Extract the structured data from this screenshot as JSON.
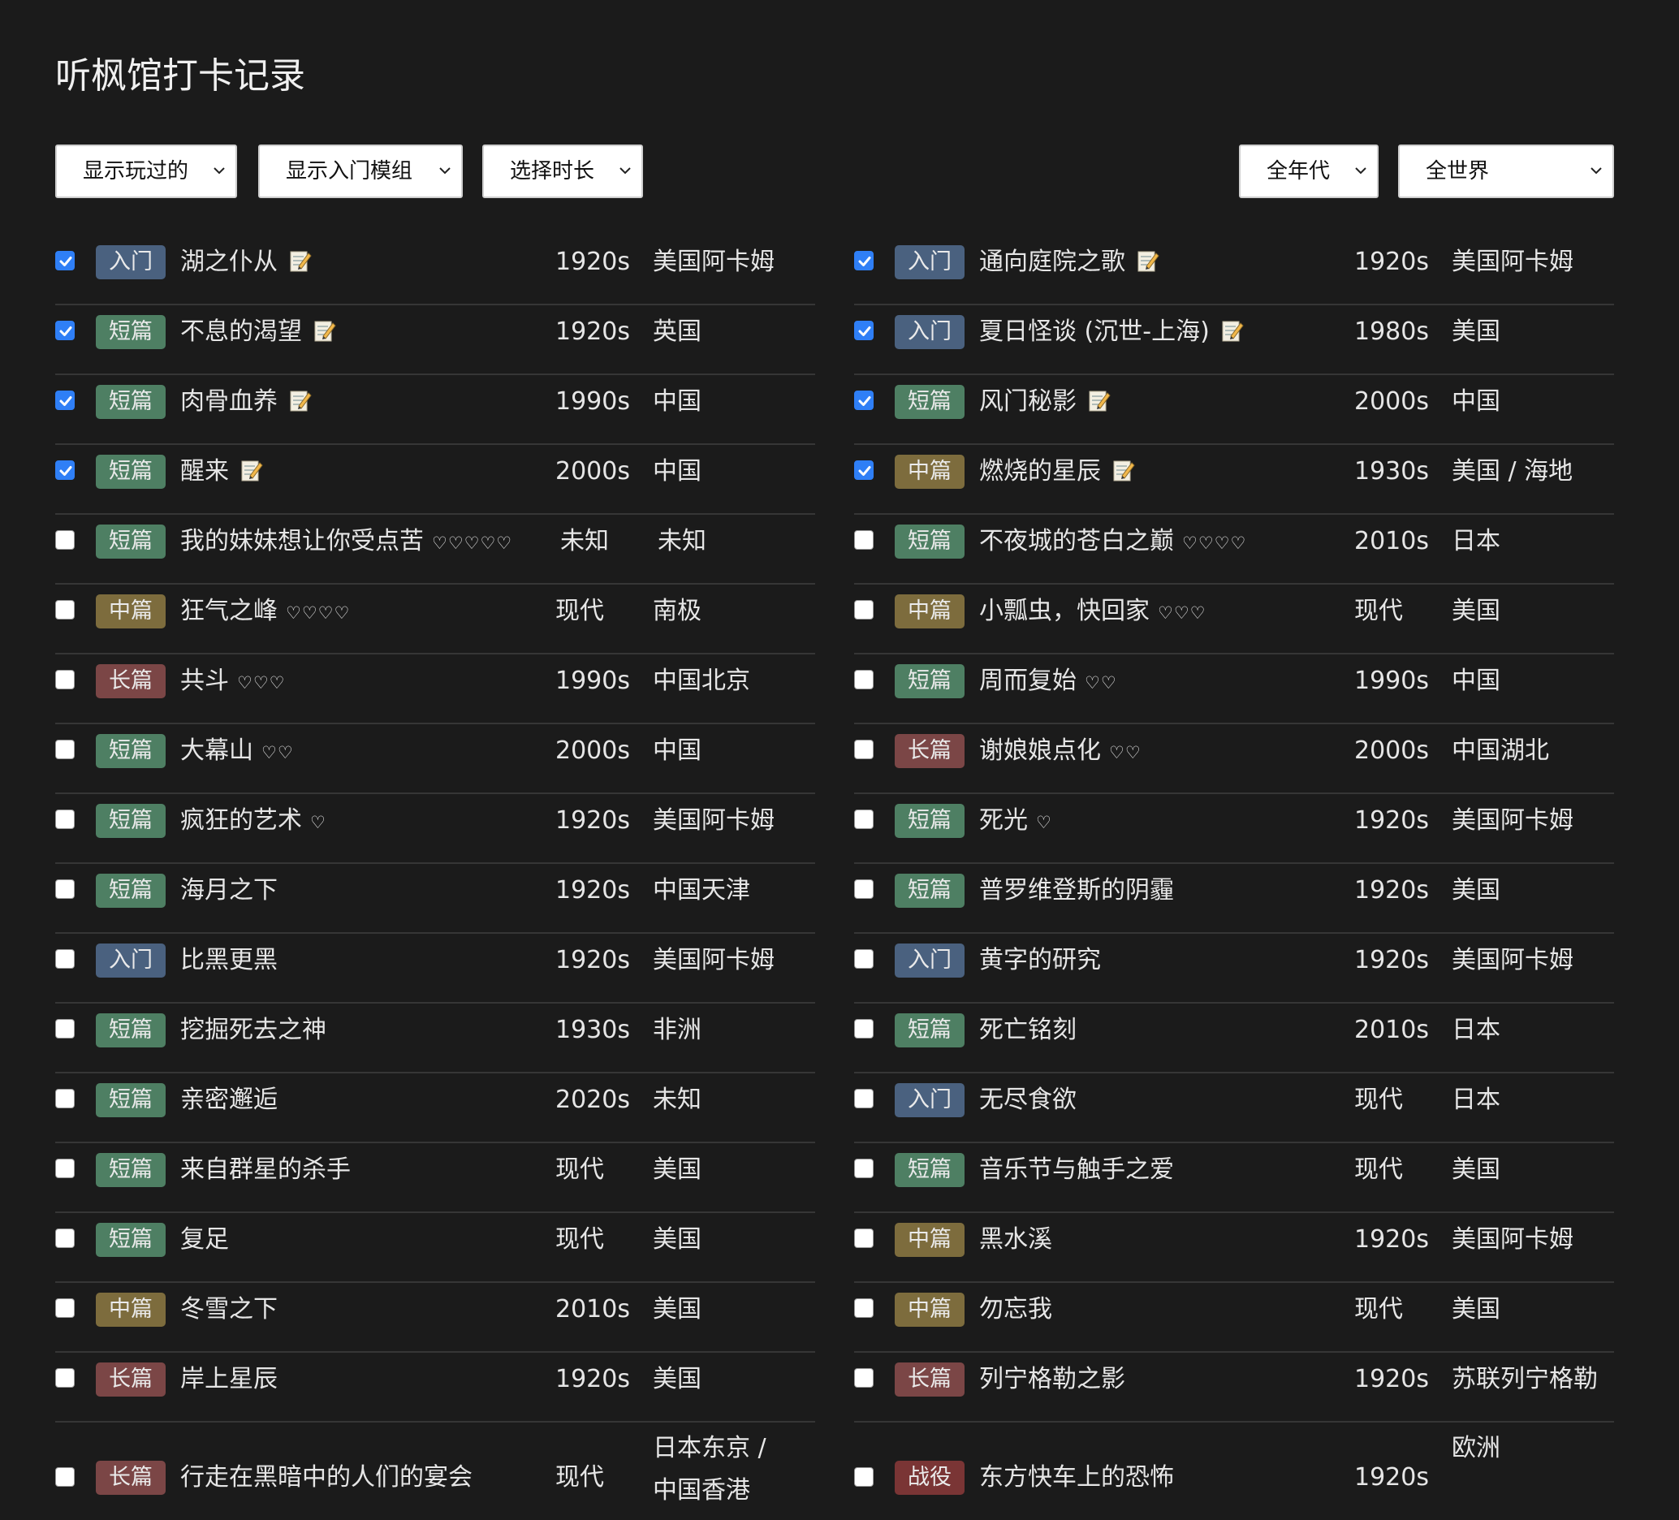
{
  "title": "听枫馆打卡记录",
  "filters": {
    "played": "显示玩过的",
    "intro": "显示入门模组",
    "duration": "选择时长",
    "era": "全年代",
    "region": "全世界"
  },
  "colors": {
    "background": "#1b1b1b",
    "checkbox_checked": "#2f7ff6",
    "tag_intro": "#4a617f",
    "tag_short": "#4e7f63",
    "tag_mid": "#7d6c3d",
    "tag_long": "#7b4646",
    "tag_campaign": "#7a3535"
  },
  "tag_labels": {
    "intro": "入门",
    "short": "短篇",
    "mid": "中篇",
    "long": "长篇",
    "campaign": "战役"
  },
  "left_rows": [
    {
      "checked": true,
      "tag": "入门",
      "type": "intro",
      "name": "湖之仆从",
      "memo": true,
      "hearts": "",
      "era": "1920s",
      "location": "美国阿卡姆"
    },
    {
      "checked": true,
      "tag": "短篇",
      "type": "short",
      "name": "不息的渴望",
      "memo": true,
      "hearts": "",
      "era": "1920s",
      "location": "英国"
    },
    {
      "checked": true,
      "tag": "短篇",
      "type": "short",
      "name": "肉骨血养",
      "memo": true,
      "hearts": "",
      "era": "1990s",
      "location": "中国"
    },
    {
      "checked": true,
      "tag": "短篇",
      "type": "short",
      "name": "醒来",
      "memo": true,
      "hearts": "",
      "era": "2000s",
      "location": "中国"
    },
    {
      "checked": false,
      "tag": "短篇",
      "type": "short",
      "name": "我的妹妹想让你受点苦",
      "memo": false,
      "hearts": "♡♡♡♡♡",
      "era": "未知",
      "location": "未知"
    },
    {
      "checked": false,
      "tag": "中篇",
      "type": "mid",
      "name": "狂气之峰",
      "memo": false,
      "hearts": "♡♡♡♡",
      "era": "现代",
      "location": "南极"
    },
    {
      "checked": false,
      "tag": "长篇",
      "type": "long",
      "name": "共斗",
      "memo": false,
      "hearts": "♡♡♡",
      "era": "1990s",
      "location": "中国北京"
    },
    {
      "checked": false,
      "tag": "短篇",
      "type": "short",
      "name": "大幕山",
      "memo": false,
      "hearts": "♡♡",
      "era": "2000s",
      "location": "中国"
    },
    {
      "checked": false,
      "tag": "短篇",
      "type": "short",
      "name": "疯狂的艺术",
      "memo": false,
      "hearts": "♡",
      "era": "1920s",
      "location": "美国阿卡姆"
    },
    {
      "checked": false,
      "tag": "短篇",
      "type": "short",
      "name": "海月之下",
      "memo": false,
      "hearts": "",
      "era": "1920s",
      "location": "中国天津"
    },
    {
      "checked": false,
      "tag": "入门",
      "type": "intro",
      "name": "比黑更黑",
      "memo": false,
      "hearts": "",
      "era": "1920s",
      "location": "美国阿卡姆"
    },
    {
      "checked": false,
      "tag": "短篇",
      "type": "short",
      "name": "挖掘死去之神",
      "memo": false,
      "hearts": "",
      "era": "1930s",
      "location": "非洲"
    },
    {
      "checked": false,
      "tag": "短篇",
      "type": "short",
      "name": "亲密邂逅",
      "memo": false,
      "hearts": "",
      "era": "2020s",
      "location": "未知"
    },
    {
      "checked": false,
      "tag": "短篇",
      "type": "short",
      "name": "来自群星的杀手",
      "memo": false,
      "hearts": "",
      "era": "现代",
      "location": "美国"
    },
    {
      "checked": false,
      "tag": "短篇",
      "type": "short",
      "name": "复足",
      "memo": false,
      "hearts": "",
      "era": "现代",
      "location": "美国"
    },
    {
      "checked": false,
      "tag": "中篇",
      "type": "mid",
      "name": "冬雪之下",
      "memo": false,
      "hearts": "",
      "era": "2010s",
      "location": "美国"
    },
    {
      "checked": false,
      "tag": "长篇",
      "type": "long",
      "name": "岸上星辰",
      "memo": false,
      "hearts": "",
      "era": "1920s",
      "location": "美国"
    },
    {
      "checked": false,
      "tag": "长篇",
      "type": "long",
      "name": "行走在黑暗中的人们的宴会",
      "memo": false,
      "hearts": "",
      "era": "现代",
      "location": "日本东京 / 中国香港"
    }
  ],
  "right_rows": [
    {
      "checked": true,
      "tag": "入门",
      "type": "intro",
      "name": "通向庭院之歌",
      "memo": true,
      "hearts": "",
      "era": "1920s",
      "location": "美国阿卡姆"
    },
    {
      "checked": true,
      "tag": "入门",
      "type": "intro",
      "name": "夏日怪谈 (沉世-上海)",
      "memo": true,
      "hearts": "",
      "era": "1980s",
      "location": "美国"
    },
    {
      "checked": true,
      "tag": "短篇",
      "type": "short",
      "name": "风门秘影",
      "memo": true,
      "hearts": "",
      "era": "2000s",
      "location": "中国"
    },
    {
      "checked": true,
      "tag": "中篇",
      "type": "mid",
      "name": "燃烧的星辰",
      "memo": true,
      "hearts": "",
      "era": "1930s",
      "location": "美国 / 海地"
    },
    {
      "checked": false,
      "tag": "短篇",
      "type": "short",
      "name": "不夜城的苍白之巅",
      "memo": false,
      "hearts": "♡♡♡♡",
      "era": "2010s",
      "location": "日本"
    },
    {
      "checked": false,
      "tag": "中篇",
      "type": "mid",
      "name": "小瓢虫，快回家",
      "memo": false,
      "hearts": "♡♡♡",
      "era": "现代",
      "location": "美国"
    },
    {
      "checked": false,
      "tag": "短篇",
      "type": "short",
      "name": "周而复始",
      "memo": false,
      "hearts": "♡♡",
      "era": "1990s",
      "location": "中国"
    },
    {
      "checked": false,
      "tag": "长篇",
      "type": "long",
      "name": "谢娘娘点化",
      "memo": false,
      "hearts": "♡♡",
      "era": "2000s",
      "location": "中国湖北"
    },
    {
      "checked": false,
      "tag": "短篇",
      "type": "short",
      "name": "死光",
      "memo": false,
      "hearts": "♡",
      "era": "1920s",
      "location": "美国阿卡姆"
    },
    {
      "checked": false,
      "tag": "短篇",
      "type": "short",
      "name": "普罗维登斯的阴霾",
      "memo": false,
      "hearts": "",
      "era": "1920s",
      "location": "美国"
    },
    {
      "checked": false,
      "tag": "入门",
      "type": "intro",
      "name": "黄字的研究",
      "memo": false,
      "hearts": "",
      "era": "1920s",
      "location": "美国阿卡姆"
    },
    {
      "checked": false,
      "tag": "短篇",
      "type": "short",
      "name": "死亡铭刻",
      "memo": false,
      "hearts": "",
      "era": "2010s",
      "location": "日本"
    },
    {
      "checked": false,
      "tag": "入门",
      "type": "intro",
      "name": "无尽食欲",
      "memo": false,
      "hearts": "",
      "era": "现代",
      "location": "日本"
    },
    {
      "checked": false,
      "tag": "短篇",
      "type": "short",
      "name": "音乐节与触手之爱",
      "memo": false,
      "hearts": "",
      "era": "现代",
      "location": "美国"
    },
    {
      "checked": false,
      "tag": "中篇",
      "type": "mid",
      "name": "黑水溪",
      "memo": false,
      "hearts": "",
      "era": "1920s",
      "location": "美国阿卡姆"
    },
    {
      "checked": false,
      "tag": "中篇",
      "type": "mid",
      "name": "勿忘我",
      "memo": false,
      "hearts": "",
      "era": "现代",
      "location": "美国"
    },
    {
      "checked": false,
      "tag": "长篇",
      "type": "long",
      "name": "列宁格勒之影",
      "memo": false,
      "hearts": "",
      "era": "1920s",
      "location": "苏联列宁格勒"
    },
    {
      "checked": false,
      "tag": "战役",
      "type": "campaign",
      "name": "东方快车上的恐怖",
      "memo": false,
      "hearts": "",
      "era": "1920s",
      "location": "欧洲"
    }
  ]
}
